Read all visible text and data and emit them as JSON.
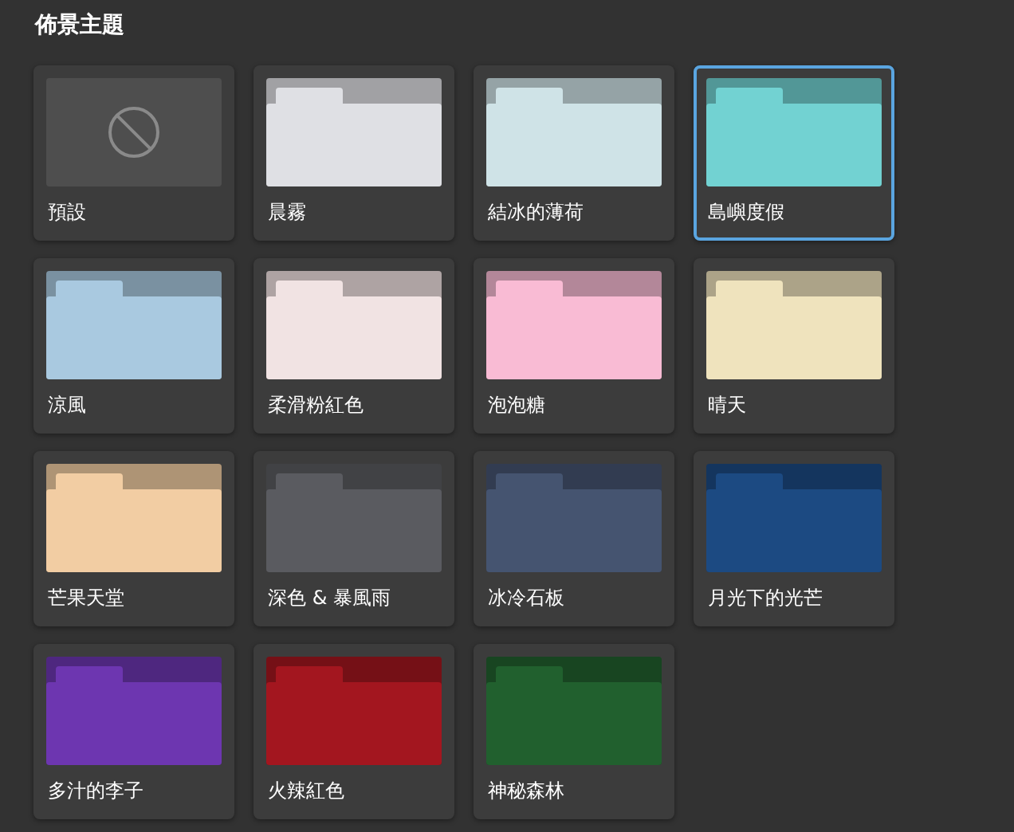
{
  "title": "佈景主題",
  "themes": [
    {
      "name": "預設",
      "kind": "none",
      "selected": false
    },
    {
      "name": "晨霧",
      "kind": "folder",
      "selected": false,
      "color": "#dfe0e4"
    },
    {
      "name": "結冰的薄荷",
      "kind": "folder",
      "selected": false,
      "color": "#cfe3e7"
    },
    {
      "name": "島嶼度假",
      "kind": "folder",
      "selected": true,
      "color": "#72d2d2"
    },
    {
      "name": "涼風",
      "kind": "folder",
      "selected": false,
      "color": "#a9c9e0"
    },
    {
      "name": "柔滑粉紅色",
      "kind": "folder",
      "selected": false,
      "color": "#f1e3e3"
    },
    {
      "name": "泡泡糖",
      "kind": "folder",
      "selected": false,
      "color": "#f9bbd4"
    },
    {
      "name": "晴天",
      "kind": "folder",
      "selected": false,
      "color": "#efe3bd"
    },
    {
      "name": "芒果天堂",
      "kind": "folder",
      "selected": false,
      "color": "#f2cda3"
    },
    {
      "name": "深色 & 暴風雨",
      "kind": "folder",
      "selected": false,
      "color": "#5a5b60"
    },
    {
      "name": "冰冷石板",
      "kind": "folder",
      "selected": false,
      "color": "#455470"
    },
    {
      "name": "月光下的光芒",
      "kind": "folder",
      "selected": false,
      "color": "#1c4a82"
    },
    {
      "name": "多汁的李子",
      "kind": "folder",
      "selected": false,
      "color": "#6d36b0"
    },
    {
      "name": "火辣紅色",
      "kind": "folder",
      "selected": false,
      "color": "#a3161f"
    },
    {
      "name": "神秘森林",
      "kind": "folder",
      "selected": false,
      "color": "#21602e"
    }
  ]
}
